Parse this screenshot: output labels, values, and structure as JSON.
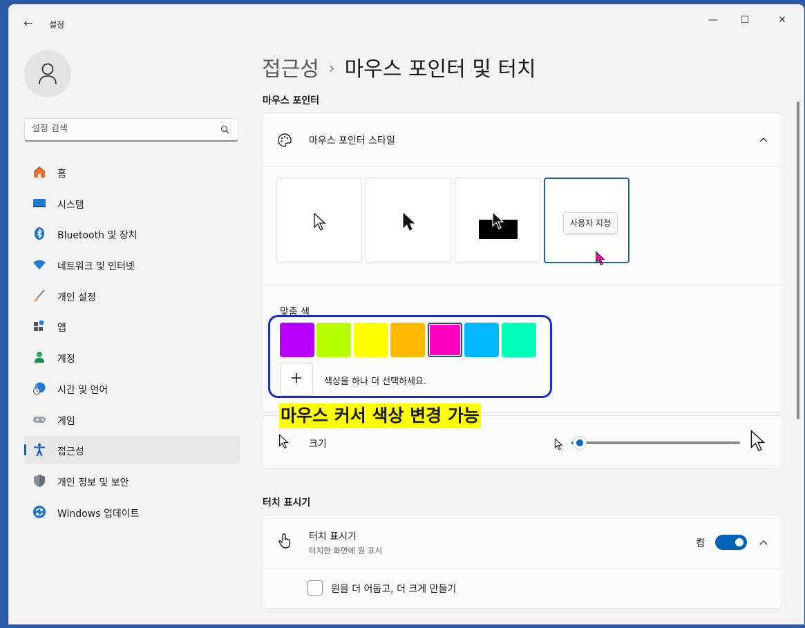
{
  "titlebar": {
    "app_title": "설정",
    "back_glyph": "←",
    "minimize": "—",
    "maximize": "☐",
    "close": "✕"
  },
  "search": {
    "placeholder": "설정 검색"
  },
  "sidebar": {
    "items": [
      {
        "label": "홈",
        "icon": "home-icon"
      },
      {
        "label": "시스템",
        "icon": "system-icon"
      },
      {
        "label": "Bluetooth 및 장치",
        "icon": "bluetooth-icon"
      },
      {
        "label": "네트워크 및 인터넷",
        "icon": "network-icon"
      },
      {
        "label": "개인 설정",
        "icon": "brush-icon"
      },
      {
        "label": "앱",
        "icon": "apps-icon"
      },
      {
        "label": "계정",
        "icon": "account-icon"
      },
      {
        "label": "시간 및 언어",
        "icon": "globe-clock-icon"
      },
      {
        "label": "게임",
        "icon": "gamepad-icon"
      },
      {
        "label": "접근성",
        "icon": "accessibility-icon",
        "active": true
      },
      {
        "label": "개인 정보 및 보안",
        "icon": "shield-icon"
      },
      {
        "label": "Windows 업데이트",
        "icon": "update-icon"
      }
    ]
  },
  "header": {
    "breadcrumb_parent": "접근성",
    "separator": "›",
    "title": "마우스 포인터 및 터치"
  },
  "mouse_pointer": {
    "section_label": "마우스 포인터",
    "style_header": "마우스 포인터 스타일",
    "styles": [
      "white-cursor",
      "black-cursor",
      "inverted-cursor",
      "custom-cursor"
    ],
    "tooltip": "사용자 지정",
    "custom_color_label": "맞춤 색",
    "swatches": [
      "#b800ff",
      "#b8ff00",
      "#ffff00",
      "#ffb900",
      "#ff00bf",
      "#00b8ff",
      "#00ffb8"
    ],
    "selected_swatch": 4,
    "pick_color_plus": "+",
    "pick_color_text": "색상을 하나 더 선택하세요.",
    "size_label": "크기",
    "size_value": 0.05
  },
  "annotation": {
    "banner": "마우스 커서 색상 변경 가능"
  },
  "touch": {
    "section_label": "터치 표시기",
    "title": "터치 표시기",
    "subtitle": "터치한 화면에 원 표시",
    "toggle_label": "켬",
    "toggle_on": true,
    "checkbox_label": "원을 더 어둡고, 더 크게 만들기"
  },
  "colors": {
    "accent": "#0067c0",
    "annotation_border": "#1a2ccf",
    "banner_bg": "#ffff00"
  }
}
